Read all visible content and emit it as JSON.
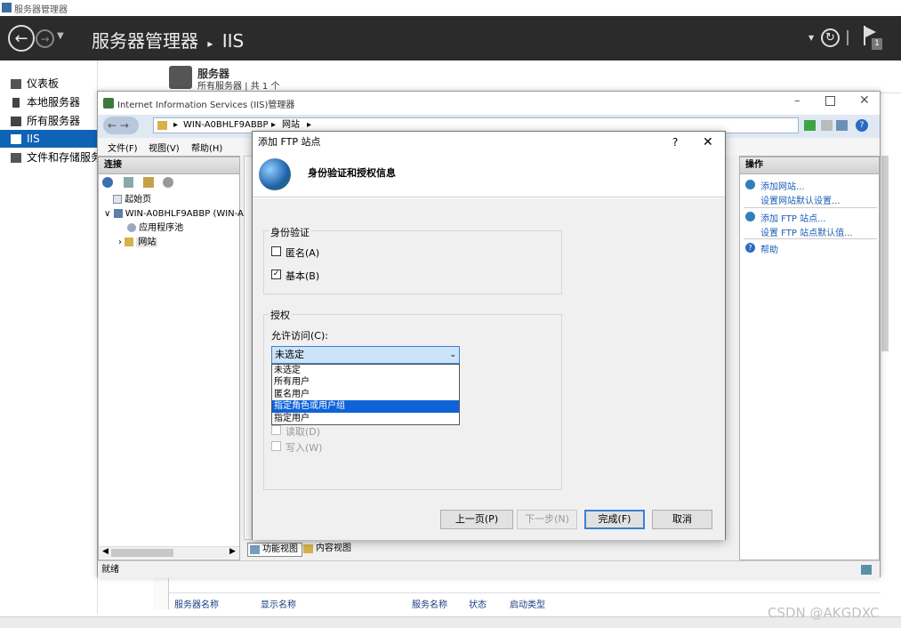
{
  "server_manager": {
    "window_title": "服务器管理器",
    "breadcrumb_root": "服务器管理器",
    "breadcrumb_sep": "▸",
    "breadcrumb_current": "IIS",
    "notification_count": "1",
    "nav": [
      {
        "label": "仪表板"
      },
      {
        "label": "本地服务器"
      },
      {
        "label": "所有服务器"
      },
      {
        "label": "IIS"
      },
      {
        "label": "文件和存储服务"
      }
    ],
    "servers_heading": "服务器",
    "servers_sub": "所有服务器 | 共 1 个",
    "services_columns": [
      "服务器名称",
      "显示名称",
      "服务名称",
      "状态",
      "启动类型"
    ]
  },
  "iis": {
    "window_title": "Internet Information Services (IIS)管理器",
    "address_parts": [
      "WIN-A0BHLF9ABBP",
      "网站"
    ],
    "menu": [
      "文件(F)",
      "视图(V)",
      "帮助(H)"
    ],
    "connections_title": "连接",
    "tree": {
      "start_page": "起始页",
      "server": "WIN-A0BHLF9ABBP (WIN-A",
      "app_pools": "应用程序池",
      "sites": "网站"
    },
    "actions_title": "操作",
    "actions": [
      {
        "label": "添加网站..."
      },
      {
        "label": "设置网站默认设置..."
      },
      {
        "label": "添加 FTP 站点..."
      },
      {
        "label": "设置 FTP 站点默认值..."
      },
      {
        "label": "帮助"
      }
    ],
    "view_tabs": [
      "功能视图",
      "内容视图"
    ],
    "status": "就绪"
  },
  "dialog": {
    "title": "添加 FTP 站点",
    "help_symbol": "?",
    "header": "身份验证和授权信息",
    "auth_group": "身份验证",
    "anonymous_label": "匿名(A)",
    "anonymous_checked": false,
    "basic_label": "基本(B)",
    "basic_checked": true,
    "authz_group": "授权",
    "allow_access_label": "允许访问(C):",
    "combo_value": "未选定",
    "dropdown_options": [
      "未选定",
      "所有用户",
      "匿名用户",
      "指定角色或用户组",
      "指定用户"
    ],
    "dropdown_selected_index": 3,
    "read_label": "读取(D)",
    "write_label": "写入(W)",
    "buttons": {
      "prev": "上一页(P)",
      "next": "下一步(N)",
      "finish": "完成(F)",
      "cancel": "取消"
    }
  },
  "watermark": "CSDN @AKGDXC",
  "colors": {
    "header_dark": "#2b2b2b",
    "nav_active": "#0f63b5",
    "link_blue": "#1a5fb4",
    "selection_blue": "#0f63d8"
  }
}
